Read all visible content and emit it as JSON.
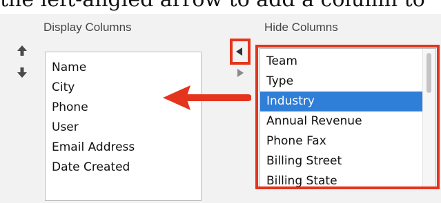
{
  "caption": "the left-angled arrow to add a column to",
  "display_columns": {
    "header": "Display Columns",
    "items": [
      "Name",
      "City",
      "Phone",
      "User",
      "Email Address",
      "Date Created"
    ]
  },
  "hide_columns": {
    "header": "Hide Columns",
    "items": [
      "Team",
      "Type",
      "Industry",
      "Annual Revenue",
      "Phone Fax",
      "Billing Street",
      "Billing State"
    ],
    "selected": "Industry"
  },
  "icons": {
    "move_up": "arrow-up-icon",
    "move_down": "arrow-down-icon",
    "move_left": "triangle-left-icon",
    "move_right": "triangle-right-icon",
    "annotation": "red-arrow-left-icon"
  },
  "colors": {
    "highlight": "#e5341d",
    "selection": "#2f7ed8",
    "panel": "#f2f2f2"
  }
}
